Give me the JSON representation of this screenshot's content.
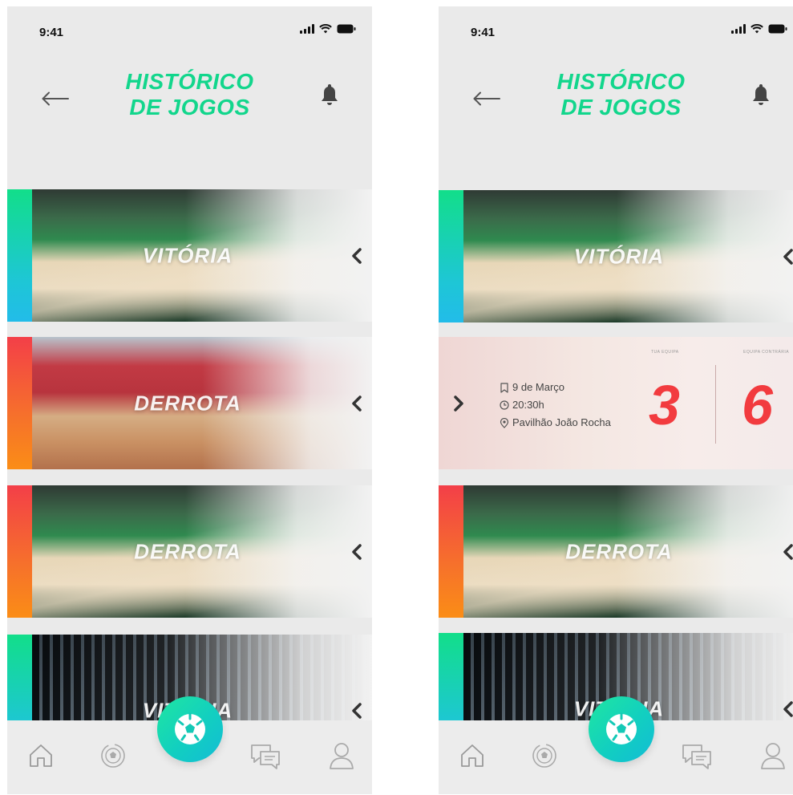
{
  "colors": {
    "accent": "#12d68c",
    "win_gradient": [
      "#12de8a",
      "#22bce9"
    ],
    "loss_gradient": [
      "#f33f48",
      "#fb8d16"
    ],
    "score": "#f23b3f",
    "background": "#eaeaea"
  },
  "left_screen": {
    "status": {
      "time": "9:41"
    },
    "header": {
      "title_line1": "HISTÓRICO",
      "title_line2": "DE JOGOS",
      "back_icon": "arrow-left-icon",
      "bell_icon": "bell-icon"
    },
    "games": [
      {
        "result": "VITÓRIA",
        "type": "win"
      },
      {
        "result": "DERROTA",
        "type": "loss"
      },
      {
        "result": "DERROTA",
        "type": "loss"
      },
      {
        "result": "VITÓRIA",
        "type": "win"
      }
    ]
  },
  "right_screen": {
    "status": {
      "time": "9:41"
    },
    "header": {
      "title_line1": "HISTÓRICO",
      "title_line2": "DE JOGOS",
      "back_icon": "arrow-left-icon",
      "bell_icon": "bell-icon"
    },
    "games": [
      {
        "result": "VITÓRIA",
        "type": "win"
      },
      {
        "result": "DERROTA",
        "type": "loss"
      },
      {
        "result": "VITÓRIA",
        "type": "win"
      }
    ],
    "detail": {
      "date": "9 de Março",
      "time": "20:30h",
      "venue": "Pavilhão João Rocha",
      "home_label": "TUA EQUIPA",
      "away_label": "EQUIPA CONTRÁRIA",
      "home_score": "3",
      "away_score": "6"
    }
  },
  "nav": {
    "items": [
      "home-icon",
      "history-icon",
      "football-icon",
      "chat-icon",
      "profile-icon"
    ]
  }
}
